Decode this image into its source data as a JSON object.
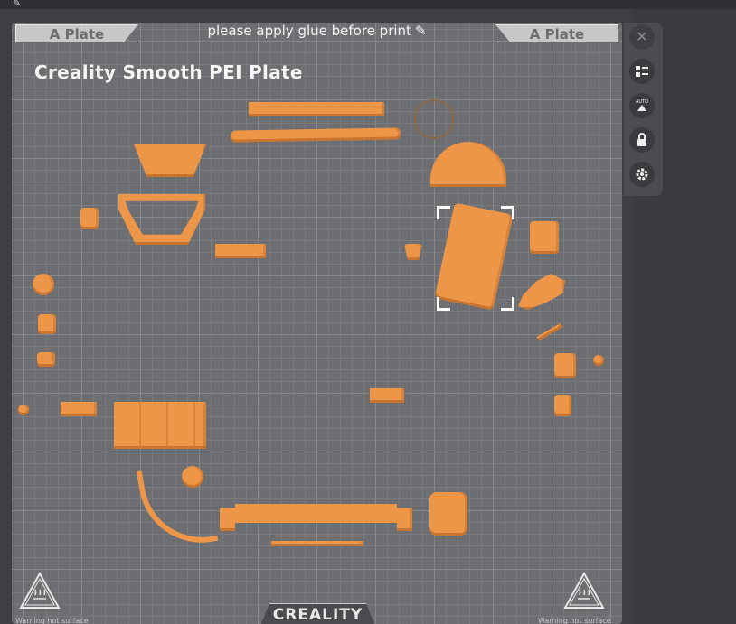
{
  "header": {
    "left_tab": "A Plate",
    "right_tab": "A Plate",
    "notice": "please apply glue before print",
    "notice_icon": "pencil-icon"
  },
  "plate": {
    "title": "Creality Smooth PEI Plate",
    "brand": "CREALITY",
    "hot_surface_label": "Warning hot surface"
  },
  "colors": {
    "model": "#ee9648",
    "bed": "#6d6e72",
    "background": "#3d3f43",
    "selection": "#ffffff"
  },
  "sidebar": {
    "buttons": [
      {
        "name": "close",
        "icon": "close-icon"
      },
      {
        "name": "arrange",
        "icon": "list-icon"
      },
      {
        "name": "auto-orient",
        "icon": "auto-icon",
        "label": "AUTO"
      },
      {
        "name": "lock",
        "icon": "lock-icon"
      },
      {
        "name": "settings",
        "icon": "gear-icon"
      }
    ]
  }
}
